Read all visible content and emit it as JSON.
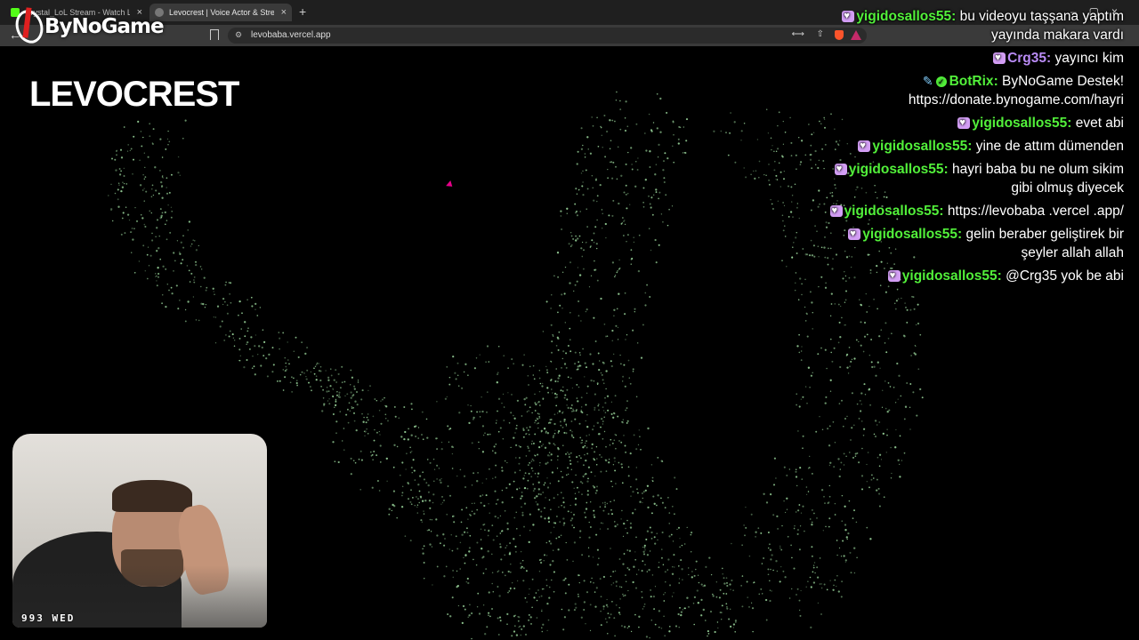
{
  "browser": {
    "tabs": [
      {
        "title": "Crystal_LoL Stream - Watch Live on K",
        "active": false
      },
      {
        "title": "Levocrest | Voice Actor & Streamer",
        "active": true
      }
    ],
    "url": "levobaba.vercel.app",
    "icons": {
      "back": "←",
      "close_tab": "×",
      "new_tab": "+",
      "translate": "⟷",
      "share": "⇧",
      "site_info": "⚙",
      "window_controls": "–▢×"
    }
  },
  "overlay": {
    "logo_text": "ByNoGame"
  },
  "page": {
    "title": "LEVOCREST",
    "background": "#000000",
    "particle_color": "#9fdca0"
  },
  "chat": {
    "messages": [
      {
        "user": "yigidosallos55",
        "color": "green",
        "badge": "heart",
        "text": "bu videoyu taşşana yaptım yayında makara vardı"
      },
      {
        "user": "Crg35",
        "color": "purple",
        "badge": "heart",
        "text": "yayıncı kim"
      },
      {
        "user": "BotRix",
        "color": "green",
        "badge": "bot",
        "text": "ByNoGame Destek! https://donate.bynogame.com/hayri"
      },
      {
        "user": "yigidosallos55",
        "color": "green",
        "badge": "heart",
        "text": "evet abi"
      },
      {
        "user": "yigidosallos55",
        "color": "green",
        "badge": "heart",
        "text": "yine de attım dümenden"
      },
      {
        "user": "yigidosallos55",
        "color": "green",
        "badge": "heart",
        "text": "hayri baba bu ne olum sikim gibi olmuş diyecek"
      },
      {
        "user": "yigidosallos55",
        "color": "green",
        "badge": "heart",
        "text": "https://levobaba .vercel .app/"
      },
      {
        "user": "yigidosallos55",
        "color": "green",
        "badge": "heart",
        "text": "gelin beraber geliştirek bir şeyler allah allah"
      },
      {
        "user": "yigidosallos55",
        "color": "green",
        "badge": "heart",
        "text": "@Crg35 yok be abi"
      }
    ]
  },
  "webcam": {
    "timestamp": "993 WED"
  }
}
